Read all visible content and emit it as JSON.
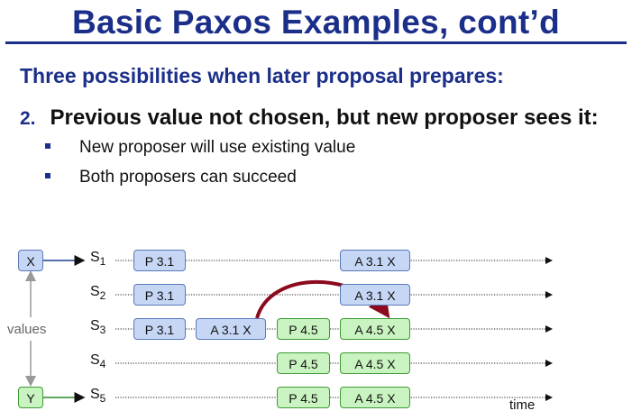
{
  "slide": {
    "title": "Basic Paxos Examples, cont’d",
    "subtitle": "Three possibilities when later proposal prepares:",
    "point_number": "2.",
    "point_text": "Previous value not chosen, but new proposer sees it:",
    "bullets": [
      "New proposer will use existing value",
      "Both proposers can succeed"
    ]
  },
  "diagram": {
    "servers": [
      "S",
      "S",
      "S",
      "S",
      "S"
    ],
    "server_subscripts": [
      "1",
      "2",
      "3",
      "4",
      "5"
    ],
    "values_label": "values",
    "time_label": "time",
    "value_x": "X",
    "value_y": "Y",
    "boxes": {
      "s1_p": "P 3.1",
      "s1_a": "A 3.1 X",
      "s2_p": "P 3.1",
      "s2_a": "A 3.1 X",
      "s3_p31": "P 3.1",
      "s3_a31": "A 3.1 X",
      "s3_p45": "P 4.5",
      "s3_a45": "A 4.5 X",
      "s4_p45": "P 4.5",
      "s4_a45": "A 4.5 X",
      "s5_p45": "P 4.5",
      "s5_a45": "A 4.5 X"
    },
    "colors": {
      "old_proposal": "#c6d6f5",
      "new_proposal": "#c9f3c0",
      "arrow": "#8b0a1e",
      "title": "#1b2f8a"
    }
  }
}
